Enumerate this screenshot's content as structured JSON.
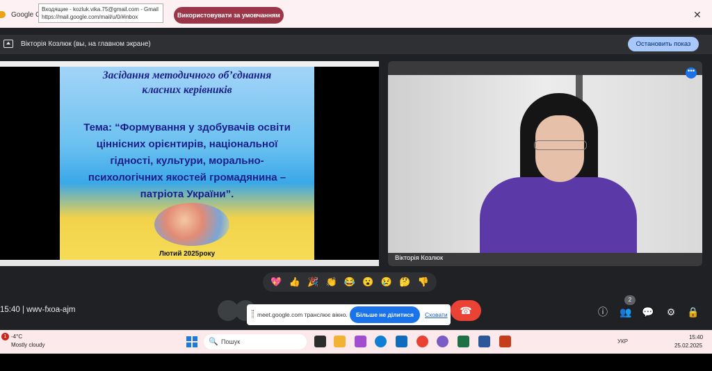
{
  "browser": {
    "tab_title": "Google Ch",
    "tooltip_line1": "Входящие - kozluk.vika.75@gmail.com - Gmail",
    "tooltip_line2": "https://mail.google.com/mail/u/0/#inbox",
    "default_button": "Використовувати за умовчанням",
    "close_glyph": "✕"
  },
  "meet": {
    "presenting_text": "Вікторія Козлюк (вы, на главном экране)",
    "stop_presenting": "Остановить показ",
    "slide": {
      "heading_line1": "Засідання методичного об’єднання",
      "heading_line2": "класних керівників",
      "body_line1": "Тема: “Формування у здобувачів освіти",
      "body_line2": "ціннісних орієнтирів, національної",
      "body_line3": "гідності, культури, морально-",
      "body_line4": "психологічних якостей громадянина –",
      "body_line5": "патріота України”.",
      "date": "Лютий 2025року"
    },
    "camera_name": "Вікторія Козлюк",
    "more_glyph": "•••",
    "reactions": [
      "💖",
      "👍",
      "🎉",
      "👏",
      "😂",
      "😮",
      "😢",
      "🤔",
      "👎"
    ],
    "time": "15:40",
    "meeting_code": "wwv-fxoa-ajm",
    "share_notice": "meet.google.com транслює вікно.",
    "stop_sharing": "Більше не ділитися",
    "hide": "Сховати",
    "people_count": "2",
    "hangup_glyph": "☎",
    "right_icons": [
      "ⓘ",
      "👥",
      "💬",
      "⚙",
      "🔒"
    ]
  },
  "taskbar": {
    "weather_badge": "1",
    "weather_temp": "-4°C",
    "weather_desc": "Mostly cloudy",
    "search_placeholder": "Пошук",
    "search_icon": "🔍",
    "lang": "УКР",
    "clock_time": "15:40",
    "clock_date": "25.02.2025",
    "app_colors": [
      "#2c2c2c",
      "#f2b233",
      "#a24dd1",
      "#0f7fd6",
      "#0f6cbd",
      "#e94235",
      "#7b5cc6",
      "#1e7145",
      "#2b579a",
      "#c43e1c"
    ]
  }
}
